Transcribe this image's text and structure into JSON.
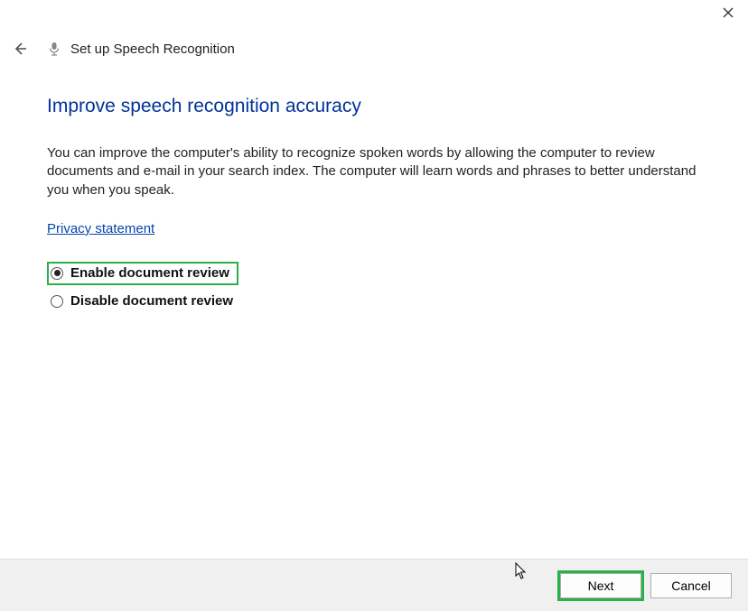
{
  "header": {
    "title": "Set up Speech Recognition"
  },
  "page": {
    "title": "Improve speech recognition accuracy",
    "description": "You can improve the computer's ability to recognize spoken words by allowing the computer to review documents and e-mail in your search index. The computer will learn words and phrases to better understand you when you speak.",
    "privacy_link": "Privacy statement"
  },
  "radios": {
    "enable_label": "Enable document review",
    "disable_label": "Disable document review"
  },
  "footer": {
    "next_label": "Next",
    "cancel_label": "Cancel"
  }
}
